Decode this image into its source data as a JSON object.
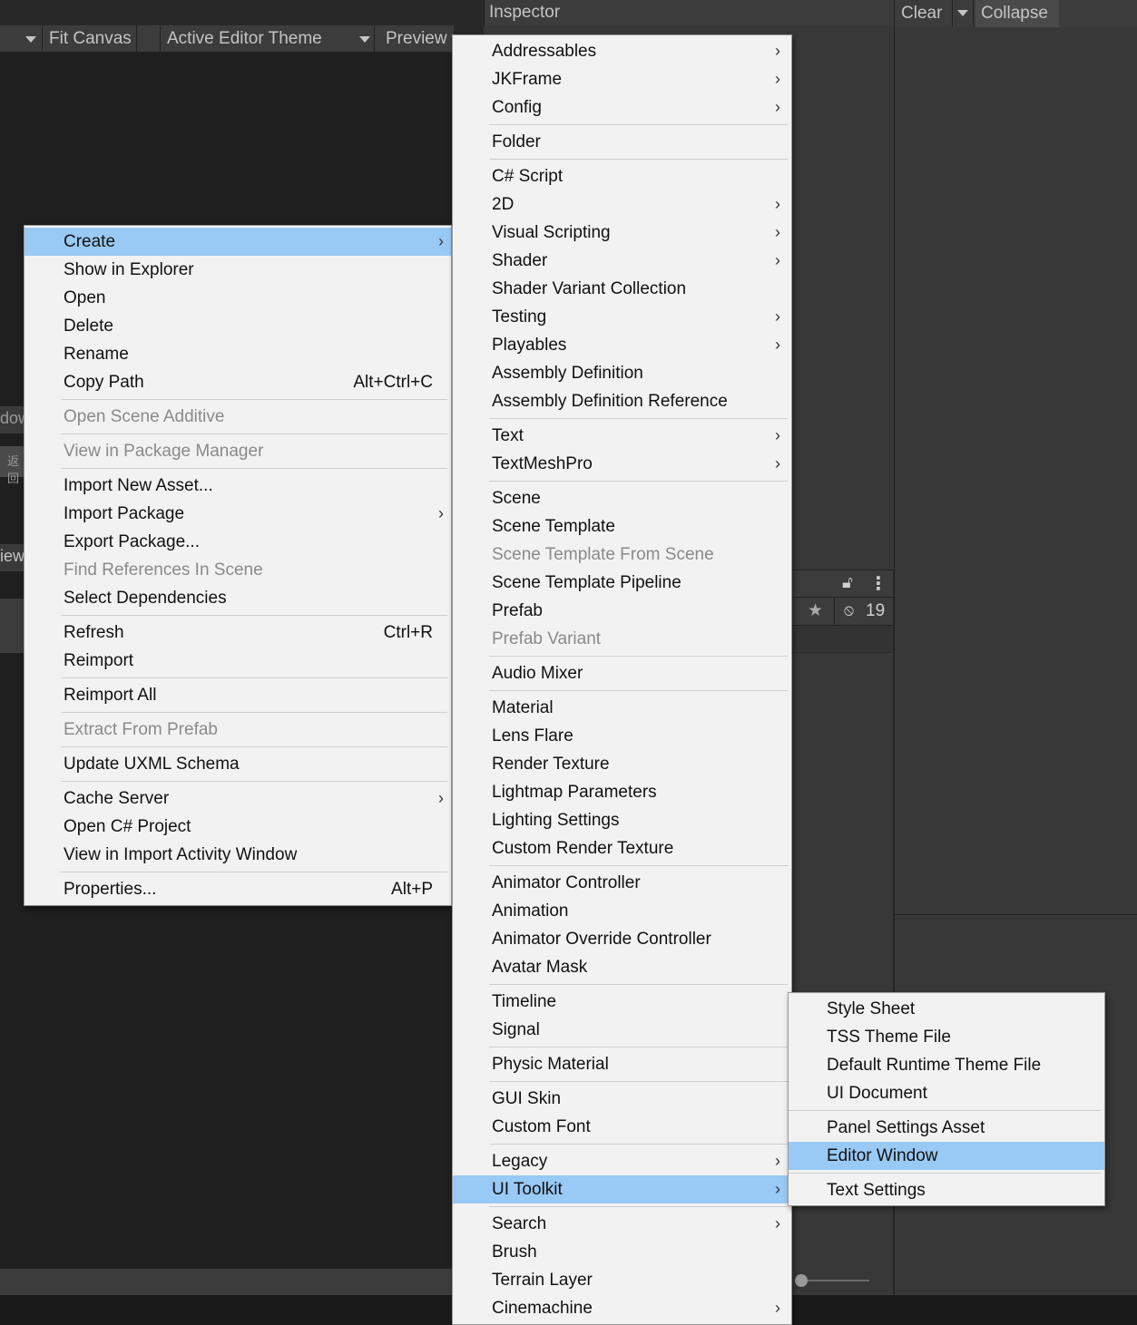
{
  "toolbar": {
    "fit_canvas": "Fit Canvas",
    "active_editor_theme": "Active Editor Theme",
    "preview": "Preview"
  },
  "inspector": {
    "tab_label": "Inspector"
  },
  "console": {
    "clear": "Clear",
    "collapse": "Collapse"
  },
  "lower_panel": {
    "hidden_count": "19"
  },
  "left_fragments": {
    "frag1": "dow",
    "frag2": "返回",
    "frag3": "iew"
  },
  "context_menu": {
    "items": [
      {
        "label": "Create",
        "submenu": true,
        "highlighted": true
      },
      {
        "label": "Show in Explorer"
      },
      {
        "label": "Open"
      },
      {
        "label": "Delete"
      },
      {
        "label": "Rename"
      },
      {
        "label": "Copy Path",
        "shortcut": "Alt+Ctrl+C"
      },
      {
        "label": "Open Scene Additive",
        "disabled": true
      },
      {
        "label": "View in Package Manager",
        "disabled": true
      },
      {
        "label": "Import New Asset..."
      },
      {
        "label": "Import Package",
        "submenu": true
      },
      {
        "label": "Export Package..."
      },
      {
        "label": "Find References In Scene",
        "disabled": true
      },
      {
        "label": "Select Dependencies"
      },
      {
        "label": "Refresh",
        "shortcut": "Ctrl+R"
      },
      {
        "label": "Reimport"
      },
      {
        "label": "Reimport All"
      },
      {
        "label": "Extract From Prefab",
        "disabled": true
      },
      {
        "label": "Update UXML Schema"
      },
      {
        "label": "Cache Server",
        "submenu": true
      },
      {
        "label": "Open C# Project"
      },
      {
        "label": "View in Import Activity Window"
      },
      {
        "label": "Properties...",
        "shortcut": "Alt+P"
      }
    ]
  },
  "create_menu": {
    "items": [
      {
        "label": "Addressables",
        "submenu": true
      },
      {
        "label": "JKFrame",
        "submenu": true
      },
      {
        "label": "Config",
        "submenu": true
      },
      {
        "label": "Folder"
      },
      {
        "label": "C# Script"
      },
      {
        "label": "2D",
        "submenu": true
      },
      {
        "label": "Visual Scripting",
        "submenu": true
      },
      {
        "label": "Shader",
        "submenu": true
      },
      {
        "label": "Shader Variant Collection"
      },
      {
        "label": "Testing",
        "submenu": true
      },
      {
        "label": "Playables",
        "submenu": true
      },
      {
        "label": "Assembly Definition"
      },
      {
        "label": "Assembly Definition Reference"
      },
      {
        "label": "Text",
        "submenu": true
      },
      {
        "label": "TextMeshPro",
        "submenu": true
      },
      {
        "label": "Scene"
      },
      {
        "label": "Scene Template"
      },
      {
        "label": "Scene Template From Scene",
        "disabled": true
      },
      {
        "label": "Scene Template Pipeline"
      },
      {
        "label": "Prefab"
      },
      {
        "label": "Prefab Variant",
        "disabled": true
      },
      {
        "label": "Audio Mixer"
      },
      {
        "label": "Material"
      },
      {
        "label": "Lens Flare"
      },
      {
        "label": "Render Texture"
      },
      {
        "label": "Lightmap Parameters"
      },
      {
        "label": "Lighting Settings"
      },
      {
        "label": "Custom Render Texture"
      },
      {
        "label": "Animator Controller"
      },
      {
        "label": "Animation"
      },
      {
        "label": "Animator Override Controller"
      },
      {
        "label": "Avatar Mask"
      },
      {
        "label": "Timeline"
      },
      {
        "label": "Signal"
      },
      {
        "label": "Physic Material"
      },
      {
        "label": "GUI Skin"
      },
      {
        "label": "Custom Font"
      },
      {
        "label": "Legacy",
        "submenu": true
      },
      {
        "label": "UI Toolkit",
        "submenu": true,
        "highlighted": true
      },
      {
        "label": "Search",
        "submenu": true
      },
      {
        "label": "Brush"
      },
      {
        "label": "Terrain Layer"
      },
      {
        "label": "Cinemachine",
        "submenu": true
      }
    ]
  },
  "ui_toolkit_menu": {
    "items": [
      {
        "label": "Style Sheet"
      },
      {
        "label": "TSS Theme File"
      },
      {
        "label": "Default Runtime Theme File"
      },
      {
        "label": "UI Document"
      },
      {
        "label": "Panel Settings Asset"
      },
      {
        "label": "Editor Window",
        "highlighted": true
      },
      {
        "label": "Text Settings"
      }
    ]
  },
  "colors": {
    "menu_bg": "#f2f2f2",
    "highlight": "#99c9f5",
    "disabled_text": "#8a8a8a",
    "editor_bg": "#282828"
  }
}
